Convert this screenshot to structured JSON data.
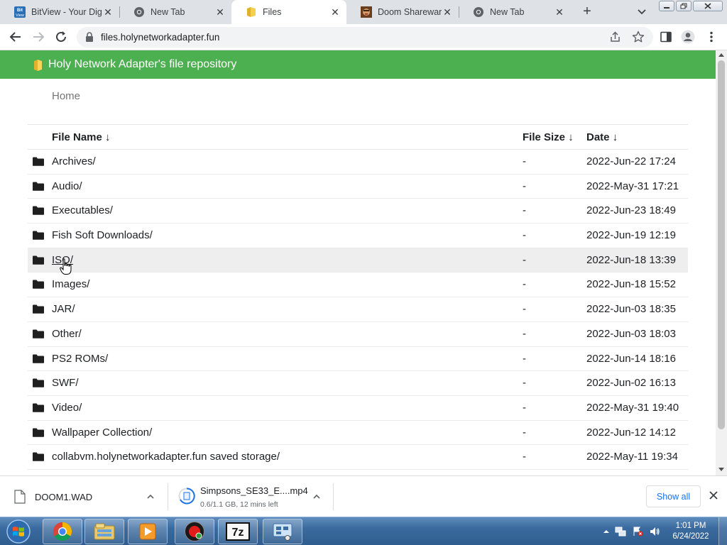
{
  "browser": {
    "tabs": [
      {
        "title": "BitView - Your Dig",
        "active": false
      },
      {
        "title": "New Tab",
        "active": false
      },
      {
        "title": "Files",
        "active": true
      },
      {
        "title": "Doom Shareware",
        "active": false
      },
      {
        "title": "New Tab",
        "active": false
      }
    ],
    "url": "files.holynetworkadapter.fun"
  },
  "page": {
    "banner_title": "Holy Network Adapter's file repository",
    "breadcrumb": "Home",
    "columns": {
      "name": "File Name  ↓",
      "size": "File Size  ↓",
      "date": "Date  ↓"
    },
    "rows": [
      {
        "name": "Archives/",
        "size": "-",
        "date": "2022-Jun-22 17:24"
      },
      {
        "name": "Audio/",
        "size": "-",
        "date": "2022-May-31 17:21"
      },
      {
        "name": "Executables/",
        "size": "-",
        "date": "2022-Jun-23 18:49"
      },
      {
        "name": "Fish Soft Downloads/",
        "size": "-",
        "date": "2022-Jun-19 12:19"
      },
      {
        "name": "ISO/",
        "size": "-",
        "date": "2022-Jun-18 13:39"
      },
      {
        "name": "Images/",
        "size": "-",
        "date": "2022-Jun-18 15:52"
      },
      {
        "name": "JAR/",
        "size": "-",
        "date": "2022-Jun-03 18:35"
      },
      {
        "name": "Other/",
        "size": "-",
        "date": "2022-Jun-03 18:03"
      },
      {
        "name": "PS2 ROMs/",
        "size": "-",
        "date": "2022-Jun-14 18:16"
      },
      {
        "name": "SWF/",
        "size": "-",
        "date": "2022-Jun-02 16:13"
      },
      {
        "name": "Video/",
        "size": "-",
        "date": "2022-May-31 19:40"
      },
      {
        "name": "Wallpaper Collection/",
        "size": "-",
        "date": "2022-Jun-12 14:12"
      },
      {
        "name": "collabvm.holynetworkadapter.fun saved storage/",
        "size": "-",
        "date": "2022-May-11 19:34"
      }
    ],
    "banner_color": "#4caf50"
  },
  "downloads": {
    "items": [
      {
        "name": "DOOM1.WAD"
      },
      {
        "name": "Simpsons_SE33_E....mp4",
        "status": "0.6/1.1 GB, 12 mins left"
      }
    ],
    "show_all": "Show all"
  },
  "taskbar": {
    "time": "1:01 PM",
    "date": "6/24/2022",
    "app_7z_label": "7z"
  }
}
